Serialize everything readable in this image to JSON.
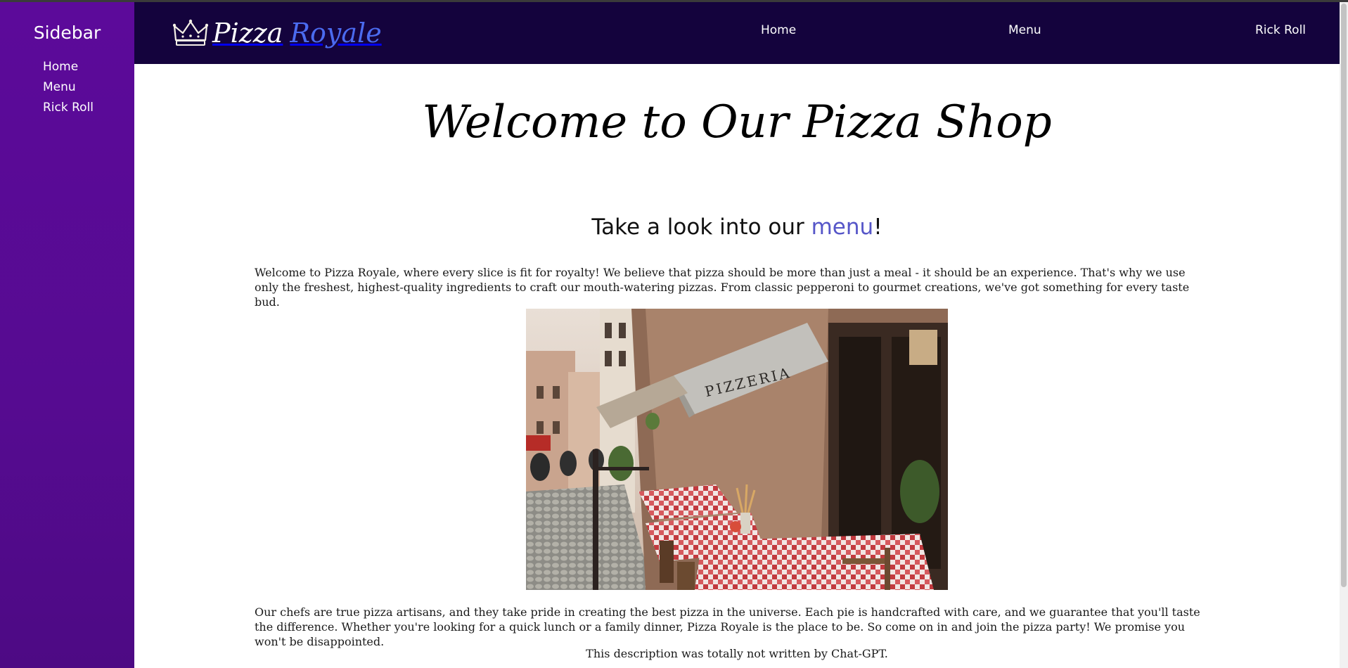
{
  "sidebar": {
    "title": "Sidebar",
    "items": [
      {
        "label": "Home"
      },
      {
        "label": "Menu"
      },
      {
        "label": "Rick Roll"
      }
    ]
  },
  "topnav": {
    "brand_part_1": "Pizza",
    "brand_part_2": "Royale",
    "brand_icon": "crown-icon",
    "links": [
      {
        "label": "Home"
      },
      {
        "label": "Menu"
      },
      {
        "label": "Rick Roll"
      }
    ]
  },
  "main": {
    "hero_title": "Welcome to Our Pizza Shop",
    "subheading_prefix": "Take a look into our ",
    "subheading_link": "menu",
    "subheading_suffix": "!",
    "paragraph_1": "Welcome to Pizza Royale, where every slice is fit for royalty! We believe that pizza should be more than just a meal - it should be an experience. That's why we use only the freshest, highest-quality ingredients to craft our mouth-watering pizzas. From classic pepperoni to gourmet creations, we've got something for every taste bud.",
    "photo_sign": "PIZZERIA",
    "paragraph_2": "Our chefs are true pizza artisans, and they take pride in creating the best pizza in the universe. Each pie is handcrafted with care, and we guarantee that you'll taste the difference. Whether you're looking for a quick lunch or a family dinner, Pizza Royale is the place to be. So come on in and join the pizza party! We promise you won't be disappointed.",
    "footnote": "This description was totally not written by Chat-GPT."
  },
  "colors": {
    "sidebar_bg": "#560b91",
    "topnav_bg": "#14033d",
    "brand_accent": "#4b6bf0",
    "link_accent": "#5656c8"
  }
}
